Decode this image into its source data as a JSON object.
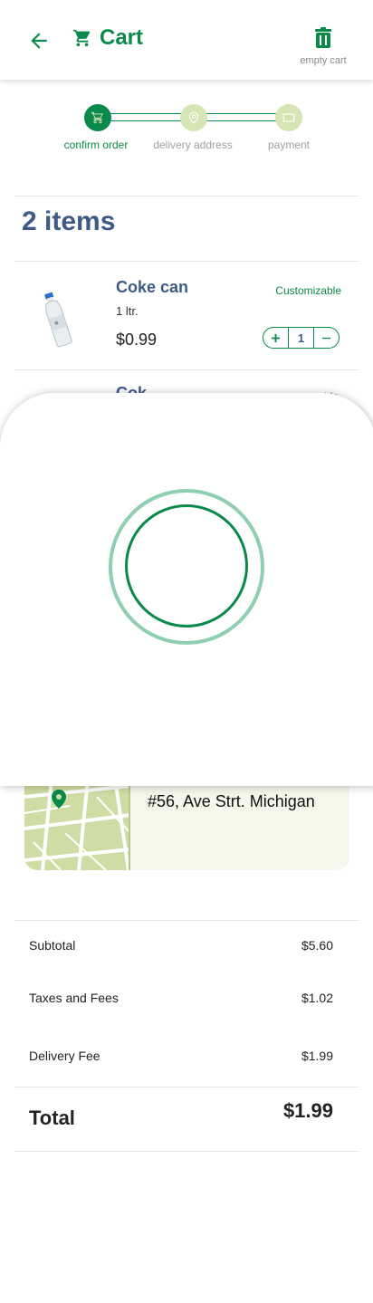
{
  "header": {
    "title": "Cart",
    "empty_cart_label": "empty cart"
  },
  "stepper": {
    "steps": [
      {
        "label": "confirm order",
        "state": "active"
      },
      {
        "label": "delivery address",
        "state": "inactive"
      },
      {
        "label": "payment",
        "state": "inactive"
      }
    ]
  },
  "cart": {
    "items_count_label": "2 items",
    "items": [
      {
        "name": "Coke can",
        "size": "1 ltr.",
        "price": "$0.99",
        "customize_label": "Customizable",
        "quantity": "1"
      }
    ],
    "partial_item": {
      "name": "Cok",
      "customize_label": "ble"
    }
  },
  "address": {
    "text": "#56, Ave Strt. Michigan"
  },
  "summary": {
    "subtotal_label": "Subtotal",
    "subtotal_value": "$5.60",
    "taxes_label": "Taxes and Fees",
    "taxes_value": "$1.02",
    "delivery_label": "Delivery Fee",
    "delivery_value": "$1.99",
    "total_label": "Total",
    "total_value": "$1.99"
  },
  "colors": {
    "brand_green": "#0a8a4a",
    "light_green": "#d6e5b4",
    "navy_text": "#3e5a87",
    "spinner_outer": "#8ecfb1"
  },
  "icons": {
    "back": "arrow-left-icon",
    "cart": "cart-icon",
    "trash": "trash-icon",
    "location": "map-pin-icon"
  }
}
